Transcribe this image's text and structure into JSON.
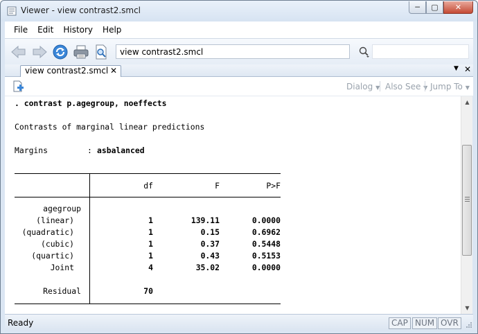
{
  "window": {
    "title": "Viewer - view contrast2.smcl"
  },
  "menubar": {
    "items": [
      "File",
      "Edit",
      "History",
      "Help"
    ]
  },
  "toolbar": {
    "address": "view contrast2.smcl",
    "find_value": ""
  },
  "tabs": [
    {
      "label": "view contrast2.smcl"
    }
  ],
  "viewer_toolbar": {
    "dialog": "Dialog",
    "also_see": "Also See",
    "jump_to": "Jump To"
  },
  "output": {
    "command": ". contrast p.agegroup, noeffects",
    "heading": "Contrasts of marginal linear predictions",
    "margins_label": "Margins",
    "margins_sep": ":",
    "margins_value": "asbalanced",
    "columns": [
      "df",
      "F",
      "P>F"
    ],
    "group_label": "agegroup",
    "rows": [
      {
        "label": "(linear)",
        "df": "1",
        "F": "139.11",
        "P": "0.0000"
      },
      {
        "label": "(quadratic)",
        "df": "1",
        "F": "0.15",
        "P": "0.6962"
      },
      {
        "label": "(cubic)",
        "df": "1",
        "F": "0.37",
        "P": "0.5448"
      },
      {
        "label": "(quartic)",
        "df": "1",
        "F": "0.43",
        "P": "0.5153"
      },
      {
        "label": "Joint",
        "df": "4",
        "F": "35.02",
        "P": "0.0000"
      }
    ],
    "residual": {
      "label": "Residual",
      "df": "70"
    }
  },
  "status": {
    "text": "Ready",
    "indicators": [
      "CAP",
      "NUM",
      "OVR"
    ]
  },
  "colors": {
    "accent": "#2a66c7",
    "title_bg": "#dbe6f3",
    "close_red": "#c44a34"
  }
}
